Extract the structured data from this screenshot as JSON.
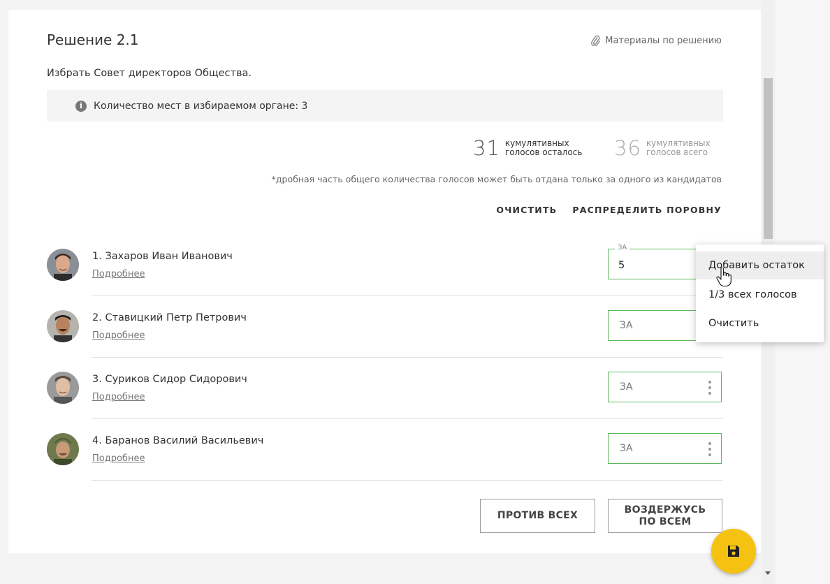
{
  "decision": {
    "title": "Решение 2.1",
    "materials_label": "Материалы по решению",
    "question": "Избрать Совет директоров Общества.",
    "info_text": "Количество мест в избираемом органе: 3"
  },
  "counters": {
    "remaining_value": "31",
    "remaining_label_1": "кумулятивных",
    "remaining_label_2": "голосов осталось",
    "total_value": "36",
    "total_label_1": "кумулятивных",
    "total_label_2": "голосов всего"
  },
  "note": "*дробная часть общего количества голосов может быть отдана только за одного из кандидатов",
  "actions": {
    "clear": "ОЧИСТИТЬ",
    "distribute": "РАСПРЕДЕЛИТЬ ПОРОВНУ"
  },
  "candidates": [
    {
      "name": "1. Захаров Иван Иванович",
      "link": "Подробнее",
      "field_label": "ЗА",
      "value": "5"
    },
    {
      "name": "2. Ставицкий Петр Петрович",
      "link": "Подробнее",
      "field_label": "ЗА",
      "value": ""
    },
    {
      "name": "3. Суриков Сидор Сидорович",
      "link": "Подробнее",
      "field_label": "ЗА",
      "value": ""
    },
    {
      "name": "4. Баранов Василий Васильевич",
      "link": "Подробнее",
      "field_label": "ЗА",
      "value": ""
    }
  ],
  "buttons": {
    "against_all": "ПРОТИВ ВСЕХ",
    "abstain_line1": "ВОЗДЕРЖУСЬ",
    "abstain_line2": "ПО ВСЕМ"
  },
  "context_menu": {
    "items": [
      "Добавить остаток",
      "1/3 всех голосов",
      "Очистить"
    ],
    "hovered": "Добавить остаток"
  },
  "colors": {
    "accent_green": "#5cb85c",
    "fab_yellow": "#f5c211"
  },
  "icons": {
    "materials": "paperclip-icon",
    "info": "info-icon",
    "save": "floppy-disk-icon",
    "more": "more-vertical-icon",
    "cursor": "hand-pointer-icon"
  }
}
